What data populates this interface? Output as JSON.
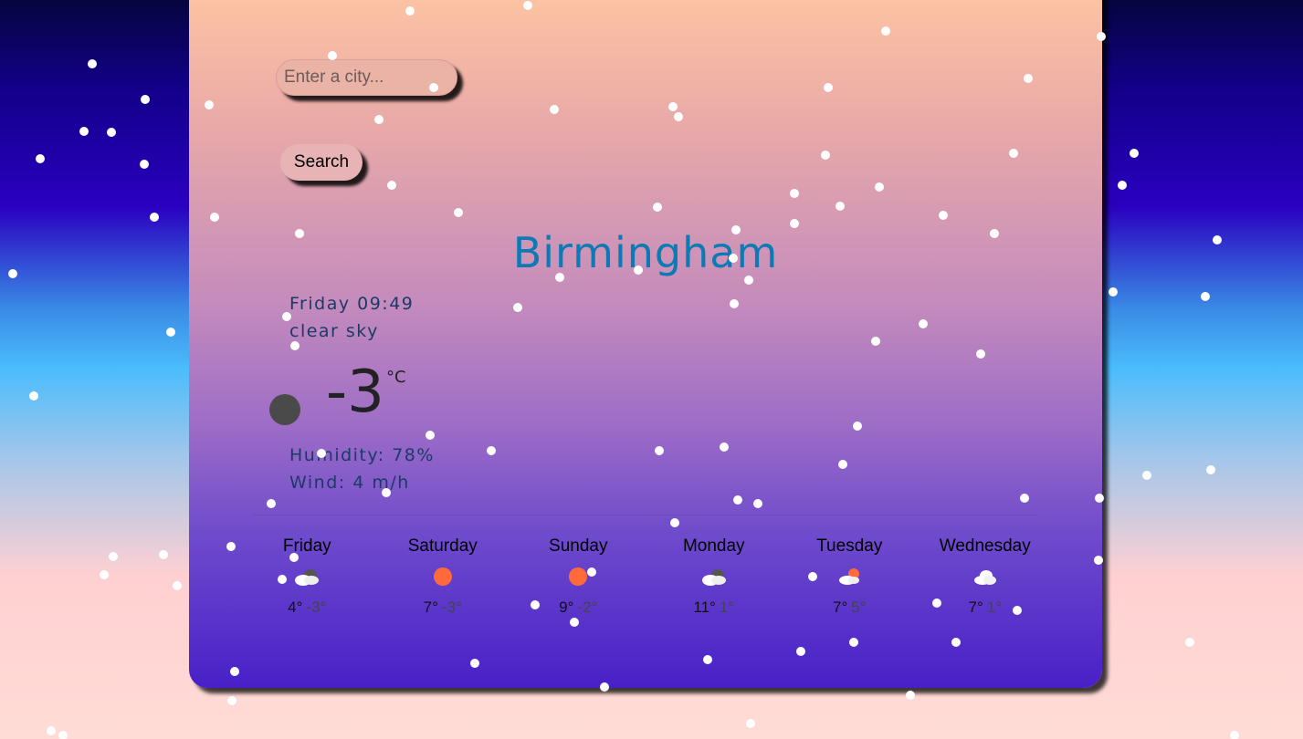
{
  "search": {
    "placeholder": "Enter a city...",
    "button_label": "Search"
  },
  "current": {
    "city": "Birmingham",
    "datetime": "Friday 09:49",
    "condition": "clear sky",
    "temperature": "-3",
    "unit": "°C",
    "humidity": "Humidity: 78%",
    "wind": "Wind: 4 m/h"
  },
  "forecast": [
    {
      "day": "Friday",
      "icon": "cloud-dark-icon",
      "high": "4°",
      "low": "-3°"
    },
    {
      "day": "Saturday",
      "icon": "sun-icon",
      "high": "7°",
      "low": "-3°"
    },
    {
      "day": "Sunday",
      "icon": "sun-icon",
      "high": "9°",
      "low": "-2°"
    },
    {
      "day": "Monday",
      "icon": "cloud-dark-icon",
      "high": "11°",
      "low": "1°"
    },
    {
      "day": "Tuesday",
      "icon": "cloud-sun-icon",
      "high": "7°",
      "low": "5°"
    },
    {
      "day": "Wednesday",
      "icon": "cloud-icon",
      "high": "7°",
      "low": "1°"
    }
  ],
  "colors": {
    "accent": "#0b7ab5",
    "sun": "#ff6a3d",
    "snow": "#ffffff"
  }
}
